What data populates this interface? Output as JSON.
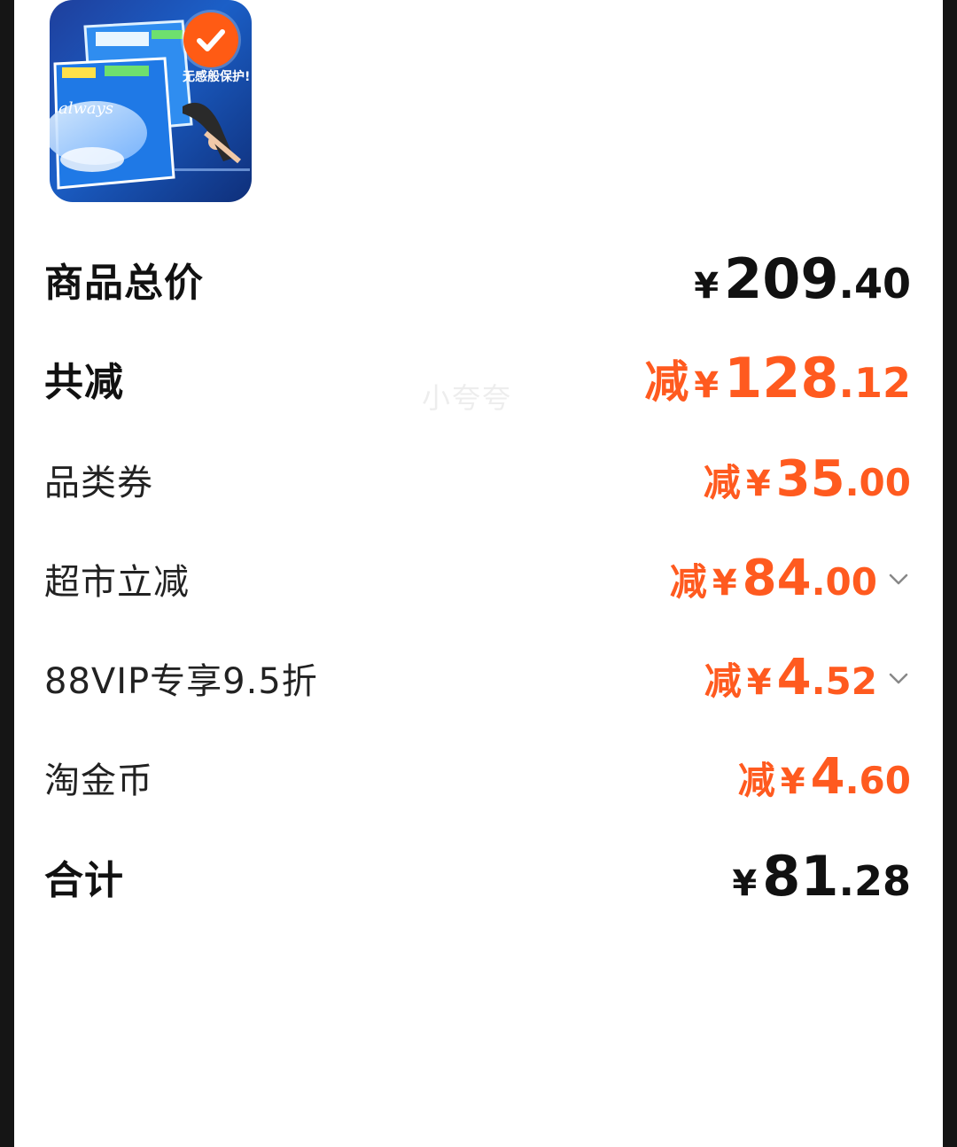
{
  "product": {
    "image_name": "always-sanitary-pad-package",
    "image_text": "无感般保护!",
    "brand": "always",
    "selected": true
  },
  "watermark": "小夸夸",
  "rows": [
    {
      "label": "商品总价",
      "prefix": "",
      "currency": "¥",
      "int": "209",
      "dec": ".40",
      "color": "#111111",
      "chevron": false
    },
    {
      "label": "共减",
      "prefix": "减",
      "currency": "¥",
      "int": "128",
      "dec": ".12",
      "color": "#ff5a1f",
      "chevron": false
    },
    {
      "label": "品类券",
      "prefix": "减",
      "currency": "¥",
      "int": "35",
      "dec": ".00",
      "color": "#ff5a1f",
      "chevron": false
    },
    {
      "label": "超市立减",
      "prefix": "减",
      "currency": "¥",
      "int": "84",
      "dec": ".00",
      "color": "#ff5a1f",
      "chevron": true
    },
    {
      "label": "88VIP专享9.5折",
      "prefix": "减",
      "currency": "¥",
      "int": "4",
      "dec": ".52",
      "color": "#ff5a1f",
      "chevron": true
    },
    {
      "label": "淘金币",
      "prefix": "减",
      "currency": "¥",
      "int": "4",
      "dec": ".60",
      "color": "#ff5a1f",
      "chevron": false
    },
    {
      "label": "合计",
      "prefix": "",
      "currency": "¥",
      "int": "81",
      "dec": ".28",
      "color": "#111111",
      "chevron": false
    }
  ]
}
